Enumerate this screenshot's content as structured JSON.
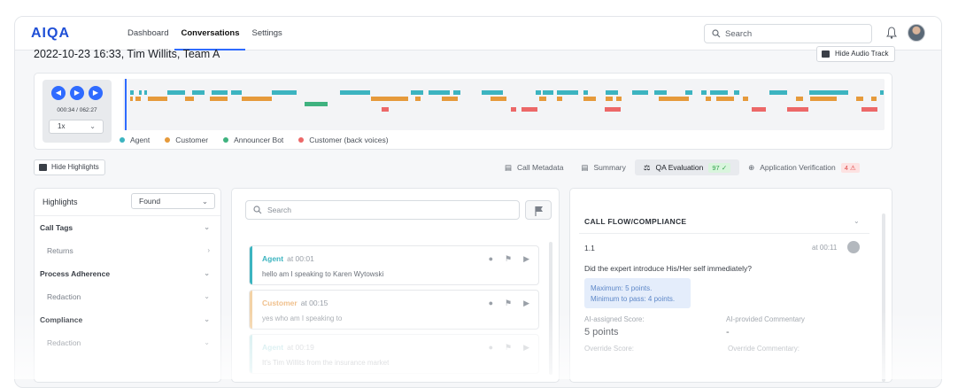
{
  "app": {
    "logo": "AIQA"
  },
  "nav": [
    "Dashboard",
    "Conversations",
    "Settings"
  ],
  "search": {
    "placeholder": "Search"
  },
  "header": {
    "title": "2022-10-23 16:33, Tim Willits, Team A",
    "hide_audio": "Hide Audio Track"
  },
  "player": {
    "time": "000:34 / 062:27",
    "speed": "1x"
  },
  "legend": [
    {
      "label": "Agent",
      "color": "#3cb4c0"
    },
    {
      "label": "Customer",
      "color": "#e69a3b"
    },
    {
      "label": "Announcer Bot",
      "color": "#3fb27f"
    },
    {
      "label": "Customer (back voices)",
      "color": "#ec6868"
    }
  ],
  "toolbar": {
    "hide_highlights": "Hide Highlights",
    "tabs": [
      {
        "label": "Call Metadata"
      },
      {
        "label": "Summary"
      },
      {
        "label": "QA Evaluation",
        "badge": "97 ✓"
      },
      {
        "label": "Application Verification",
        "badge": "4"
      }
    ]
  },
  "highlights": {
    "label": "Highlights",
    "filter": "Found",
    "sections": [
      {
        "title": "Call Tags",
        "sub": "Returns"
      },
      {
        "title": "Process Adherence",
        "sub": "Redaction"
      },
      {
        "title": "Compliance",
        "sub": "Redaction"
      }
    ]
  },
  "transcript": {
    "search_placeholder": "Search",
    "messages": [
      {
        "speaker": "Agent",
        "time": "at 00:01",
        "text": "hello am I speaking to Karen Wytowski"
      },
      {
        "speaker": "Customer",
        "time": "at 00:15",
        "text": "yes who am I speaking to"
      },
      {
        "speaker": "Agent",
        "time": "at 00:19",
        "text": "It's Tim Willits from the insurance market"
      }
    ]
  },
  "qa": {
    "section": "CALL FLOW/COMPLIANCE",
    "num": "1.1",
    "at": "at 00:11",
    "question": "Did the expert introduce His/Her self immediately?",
    "maximum": "Maximum: 5 points.",
    "minimum": "Minimum to pass: 4 points.",
    "ai_score_label": "AI-assigned Score:",
    "ai_score": "5 points",
    "ai_comment_label": "AI-provided Commentary",
    "ai_comment": "-",
    "override_score_label": "Override Score:",
    "override_comment_label": "Override Commentary:"
  }
}
